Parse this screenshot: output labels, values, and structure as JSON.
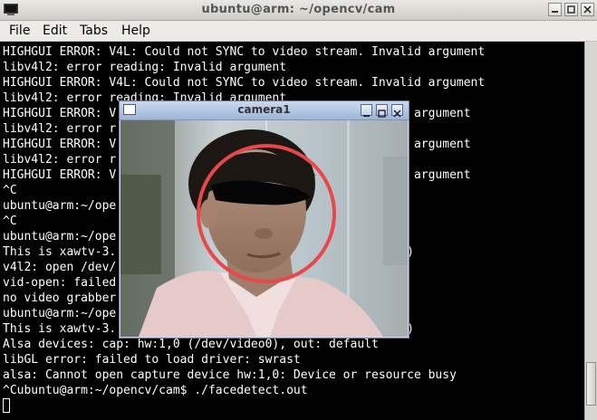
{
  "window": {
    "title": "ubuntu@arm: ~/opencv/cam",
    "icon": "terminal-icon"
  },
  "menu": {
    "file": "File",
    "edit": "Edit",
    "tabs": "Tabs",
    "help": "Help"
  },
  "terminal": {
    "lines": [
      "HIGHGUI ERROR: V4L: Could not SYNC to video stream. Invalid argument",
      "libv4l2: error reading: Invalid argument",
      "HIGHGUI ERROR: V4L: Could not SYNC to video stream. Invalid argument",
      "libv4l2: error reading: Invalid argument",
      "HIGHGUI ERROR: V                                       id argument",
      "libv4l2: error r",
      "HIGHGUI ERROR: V                                       id argument",
      "libv4l2: error r",
      "HIGHGUI ERROR: V                                       id argument",
      "^C",
      "ubuntu@arm:~/ope",
      "^C",
      "ubuntu@arm:~/ope",
      "This is xawtv-3.                                      e49)",
      "v4l2: open /dev/",
      "vid-open: failed",
      "no video grabber",
      "ubuntu@arm:~/ope",
      "This is xawtv-3.                                      e49)",
      "Alsa devices: cap: hw:1,0 (/dev/video0), out: default",
      "libGL error: failed to load driver: swrast",
      "alsa: Cannot open capture device hw:1,0: Device or resource busy",
      "^Cubuntu@arm:~/opencv/cam$ ./facedetect.out"
    ]
  },
  "camera_window": {
    "title": "camera1"
  },
  "colors": {
    "terminal_bg": "#000000",
    "terminal_fg": "#ffffff",
    "detection_circle": "#e8474b"
  }
}
